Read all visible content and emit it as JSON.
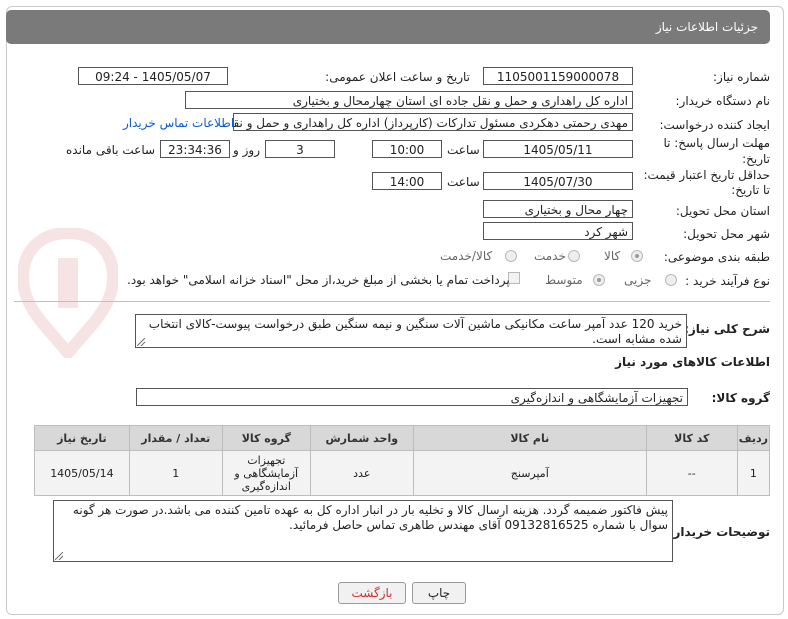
{
  "header": {
    "title": "جزئیات اطلاعات نیاز"
  },
  "fields": {
    "need_number": {
      "label": "شماره نیاز:",
      "value": "1105001159000078"
    },
    "announce_datetime": {
      "label": "تاریخ و ساعت اعلان عمومی:",
      "value": "1405/05/07 - 09:24"
    },
    "buyer_org": {
      "label": "نام دستگاه خریدار:",
      "value": "اداره کل راهداری و حمل و نقل جاده ای استان چهارمحال و بختیاری"
    },
    "requester": {
      "label": "ایجاد کننده درخواست:",
      "value": "مهدی رحمتی دهکردی مسئول تدارکات (کارپرداز) اداره کل راهداری و حمل و نقل",
      "link": "اطلاعات تماس خریدار"
    },
    "reply_deadline": {
      "label_line1": "مهلت ارسال پاسخ: تا",
      "label_line2": "تاریخ:",
      "date": "1405/05/11",
      "time_label": "ساعت",
      "time": "10:00",
      "days": "3",
      "days_label": "روز و",
      "remaining": "23:34:36",
      "remaining_label": "ساعت باقی مانده"
    },
    "price_validity": {
      "label_line1": "حداقل تاریخ اعتبار قیمت:",
      "label_line2": "تا تاریخ:",
      "date": "1405/07/30",
      "time_label": "ساعت",
      "time": "14:00"
    },
    "delivery_province": {
      "label": "استان محل تحویل:",
      "value": "چهار محال و بختیاری"
    },
    "delivery_city": {
      "label": "شهر محل تحویل:",
      "value": "شهر کرد"
    },
    "category": {
      "label": "طبقه بندی موضوعی:",
      "options": [
        "کالا",
        "خدمت",
        "کالا/خدمت"
      ],
      "selected": "کالا"
    },
    "purchase_type": {
      "label": "نوع فرآیند خرید :",
      "options": [
        "جزیی",
        "متوسط"
      ],
      "selected": "متوسط",
      "note": "پرداخت تمام یا بخشی از مبلغ خرید،از محل \"اسناد خزانه اسلامی\" خواهد بود."
    }
  },
  "description": {
    "label": "شرح کلی نیاز:",
    "value": "خرید 120 عدد آمپر ساعت مکانیکی ماشین آلات سنگین و نیمه سنگین طبق درخواست پیوست-کالای انتخاب شده مشابه است."
  },
  "goods_section": {
    "title": "اطلاعات کالاهای مورد نیاز"
  },
  "goods_group": {
    "label": "گروه کالا:",
    "value": "تجهیزات آزمایشگاهی و اندازه‌گیری"
  },
  "table": {
    "headers": [
      "ردیف",
      "کد کالا",
      "نام کالا",
      "واحد شمارش",
      "گروه کالا",
      "تعداد / مقدار",
      "تاریخ نیاز"
    ],
    "rows": [
      [
        "1",
        "--",
        "آمپرسنج",
        "عدد",
        "تجهیزات آزمایشگاهی و اندازه‌گیری",
        "1",
        "1405/05/14"
      ]
    ]
  },
  "buyer_notes": {
    "label": "توضیحات خریدار:",
    "value": "پیش فاکتور ضمیمه گردد. هزینه ارسال کالا و تخلیه بار در انبار اداره کل به عهده تامین کننده می باشد.در صورت هر گونه سوال با شماره 09132816525 آقای مهندس طاهری تماس حاصل فرمائید."
  },
  "buttons": {
    "print": "چاپ",
    "back": "بازگشت"
  },
  "colors": {
    "header_bg": "#7a7a7a",
    "link": "#0a5ad6",
    "table_header": "#d8d8d8",
    "back_button_text": "#d03030"
  }
}
